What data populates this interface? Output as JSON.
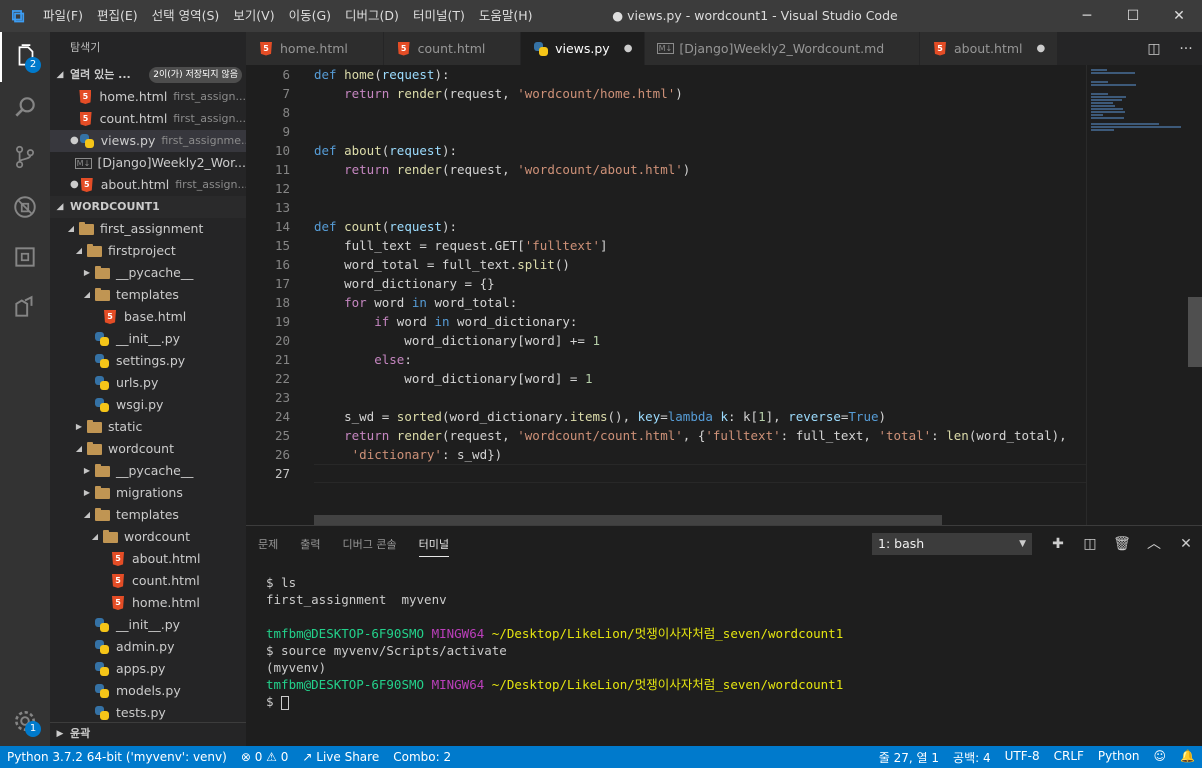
{
  "menu": [
    "파일(F)",
    "편집(E)",
    "선택 영역(S)",
    "보기(V)",
    "이동(G)",
    "디버그(D)",
    "터미널(T)",
    "도움말(H)"
  ],
  "window_title": "● views.py - wordcount1 - Visual Studio Code",
  "activity": {
    "explorer_badge": "2",
    "settings_badge": "1"
  },
  "sidebar": {
    "title": "탐색기",
    "open_editors": {
      "label": "열려 있는 ...",
      "badge": "2이(가) 저장되지 않음",
      "items": [
        {
          "name": "home.html",
          "desc": "first_assign...",
          "dot": ""
        },
        {
          "name": "count.html",
          "desc": "first_assign...",
          "dot": ""
        },
        {
          "name": "views.py",
          "desc": "first_assignme...",
          "dot": "●"
        },
        {
          "name": "[Django]Weekly2_Wor...",
          "desc": "",
          "dot": ""
        },
        {
          "name": "about.html",
          "desc": "first_assign...",
          "dot": "●"
        }
      ]
    },
    "workspace": "WORDCOUNT1",
    "tree": [
      {
        "name": "first_assignment",
        "depth": 1,
        "type": "folder",
        "open": true
      },
      {
        "name": "firstproject",
        "depth": 2,
        "type": "folder",
        "open": true
      },
      {
        "name": "__pycache__",
        "depth": 3,
        "type": "folder",
        "open": false
      },
      {
        "name": "templates",
        "depth": 3,
        "type": "folder",
        "open": true
      },
      {
        "name": "base.html",
        "depth": 4,
        "type": "html"
      },
      {
        "name": "__init__.py",
        "depth": 3,
        "type": "py"
      },
      {
        "name": "settings.py",
        "depth": 3,
        "type": "py"
      },
      {
        "name": "urls.py",
        "depth": 3,
        "type": "py"
      },
      {
        "name": "wsgi.py",
        "depth": 3,
        "type": "py"
      },
      {
        "name": "static",
        "depth": 2,
        "type": "folder",
        "open": false
      },
      {
        "name": "wordcount",
        "depth": 2,
        "type": "folder",
        "open": true
      },
      {
        "name": "__pycache__",
        "depth": 3,
        "type": "folder",
        "open": false
      },
      {
        "name": "migrations",
        "depth": 3,
        "type": "folder",
        "open": false
      },
      {
        "name": "templates",
        "depth": 3,
        "type": "folder",
        "open": true
      },
      {
        "name": "wordcount",
        "depth": 4,
        "type": "folder",
        "open": true
      },
      {
        "name": "about.html",
        "depth": 5,
        "type": "html"
      },
      {
        "name": "count.html",
        "depth": 5,
        "type": "html"
      },
      {
        "name": "home.html",
        "depth": 5,
        "type": "html"
      },
      {
        "name": "__init__.py",
        "depth": 3,
        "type": "py"
      },
      {
        "name": "admin.py",
        "depth": 3,
        "type": "py"
      },
      {
        "name": "apps.py",
        "depth": 3,
        "type": "py"
      },
      {
        "name": "models.py",
        "depth": 3,
        "type": "py"
      },
      {
        "name": "tests.py",
        "depth": 3,
        "type": "py"
      }
    ],
    "outline": "윤곽"
  },
  "tabs": [
    {
      "name": "home.html",
      "type": "html",
      "dirty": false,
      "active": false
    },
    {
      "name": "count.html",
      "type": "html",
      "dirty": false,
      "active": false
    },
    {
      "name": "views.py",
      "type": "py",
      "dirty": true,
      "active": true
    },
    {
      "name": "[Django]Weekly2_Wordcount.md",
      "type": "md",
      "dirty": false,
      "active": false
    },
    {
      "name": "about.html",
      "type": "html",
      "dirty": true,
      "active": false
    }
  ],
  "editor": {
    "current_line": "27",
    "lines": [
      {
        "n": "6",
        "t": [
          [
            "k",
            "def "
          ],
          [
            "f",
            "home"
          ],
          [
            "p",
            "("
          ],
          [
            "v",
            "request"
          ],
          [
            "p",
            "):"
          ]
        ]
      },
      {
        "n": "7",
        "t": [
          [
            "p",
            "    "
          ],
          [
            "c",
            "return "
          ],
          [
            "f",
            "render"
          ],
          [
            "p",
            "(request, "
          ],
          [
            "s",
            "'wordcount/home.html'"
          ],
          [
            "p",
            ")"
          ]
        ]
      },
      {
        "n": "8",
        "t": []
      },
      {
        "n": "9",
        "t": []
      },
      {
        "n": "10",
        "t": [
          [
            "k",
            "def "
          ],
          [
            "f",
            "about"
          ],
          [
            "p",
            "("
          ],
          [
            "v",
            "request"
          ],
          [
            "p",
            "):"
          ]
        ]
      },
      {
        "n": "11",
        "t": [
          [
            "p",
            "    "
          ],
          [
            "c",
            "return "
          ],
          [
            "f",
            "render"
          ],
          [
            "p",
            "(request, "
          ],
          [
            "s",
            "'wordcount/about.html'"
          ],
          [
            "p",
            ")"
          ]
        ]
      },
      {
        "n": "12",
        "t": []
      },
      {
        "n": "13",
        "t": []
      },
      {
        "n": "14",
        "t": [
          [
            "k",
            "def "
          ],
          [
            "f",
            "count"
          ],
          [
            "p",
            "("
          ],
          [
            "v",
            "request"
          ],
          [
            "p",
            "):"
          ]
        ]
      },
      {
        "n": "15",
        "t": [
          [
            "p",
            "    full_text = request.GET["
          ],
          [
            "s",
            "'fulltext'"
          ],
          [
            "p",
            "]"
          ]
        ]
      },
      {
        "n": "16",
        "t": [
          [
            "p",
            "    word_total = full_text."
          ],
          [
            "f",
            "split"
          ],
          [
            "p",
            "()"
          ]
        ]
      },
      {
        "n": "17",
        "t": [
          [
            "p",
            "    word_dictionary = {}"
          ]
        ]
      },
      {
        "n": "18",
        "t": [
          [
            "p",
            "    "
          ],
          [
            "c",
            "for "
          ],
          [
            "p",
            "word "
          ],
          [
            "k",
            "in "
          ],
          [
            "p",
            "word_total:"
          ]
        ]
      },
      {
        "n": "19",
        "t": [
          [
            "p",
            "        "
          ],
          [
            "c",
            "if "
          ],
          [
            "p",
            "word "
          ],
          [
            "k",
            "in "
          ],
          [
            "p",
            "word_dictionary:"
          ]
        ]
      },
      {
        "n": "20",
        "t": [
          [
            "p",
            "            word_dictionary[word] += "
          ],
          [
            "n",
            "1"
          ]
        ]
      },
      {
        "n": "21",
        "t": [
          [
            "p",
            "        "
          ],
          [
            "c",
            "else"
          ],
          [
            "p",
            ":"
          ]
        ]
      },
      {
        "n": "22",
        "t": [
          [
            "p",
            "            word_dictionary[word] = "
          ],
          [
            "n",
            "1"
          ]
        ]
      },
      {
        "n": "23",
        "t": []
      },
      {
        "n": "24",
        "t": [
          [
            "p",
            "    s_wd = "
          ],
          [
            "f",
            "sorted"
          ],
          [
            "p",
            "(word_dictionary."
          ],
          [
            "f",
            "items"
          ],
          [
            "p",
            "(), "
          ],
          [
            "v",
            "key"
          ],
          [
            "p",
            "="
          ],
          [
            "k",
            "lambda "
          ],
          [
            "v",
            "k"
          ],
          [
            "p",
            ": k["
          ],
          [
            "n",
            "1"
          ],
          [
            "p",
            "], "
          ],
          [
            "v",
            "reverse"
          ],
          [
            "p",
            "="
          ],
          [
            "k",
            "True"
          ],
          [
            "p",
            ")"
          ]
        ]
      },
      {
        "n": "25",
        "t": [
          [
            "p",
            "    "
          ],
          [
            "c",
            "return "
          ],
          [
            "f",
            "render"
          ],
          [
            "p",
            "(request, "
          ],
          [
            "s",
            "'wordcount/count.html'"
          ],
          [
            "p",
            ", {"
          ],
          [
            "s",
            "'fulltext'"
          ],
          [
            "p",
            ": full_text, "
          ],
          [
            "s",
            "'total'"
          ],
          [
            "p",
            ": "
          ],
          [
            "f",
            "len"
          ],
          [
            "p",
            "(word_total),"
          ]
        ]
      },
      {
        "n": "26",
        "t": [
          [
            "p",
            "     "
          ],
          [
            "s",
            "'dictionary'"
          ],
          [
            "p",
            ": s_wd})"
          ]
        ]
      },
      {
        "n": "27",
        "t": []
      }
    ]
  },
  "panel": {
    "tabs": [
      {
        "label": "문제",
        "active": false
      },
      {
        "label": "출력",
        "active": false
      },
      {
        "label": "디버그 콘솔",
        "active": false
      },
      {
        "label": "터미널",
        "active": true
      }
    ],
    "terminal_select": "1: bash",
    "terminal": [
      [
        [
          "p",
          "$ ls"
        ]
      ],
      [
        [
          "p",
          "first_assignment  myvenv"
        ]
      ],
      [],
      [
        [
          "g",
          "tmfbm@DESKTOP-6F90SMO "
        ],
        [
          "m",
          "MINGW64 "
        ],
        [
          "y",
          "~/Desktop/LikeLion/멋쟁이사자처럼_seven/wordcount1"
        ]
      ],
      [
        [
          "p",
          "$ source myvenv/Scripts/activate"
        ]
      ],
      [
        [
          "p",
          "(myvenv)"
        ]
      ],
      [
        [
          "g",
          "tmfbm@DESKTOP-6F90SMO "
        ],
        [
          "m",
          "MINGW64 "
        ],
        [
          "y",
          "~/Desktop/LikeLion/멋쟁이사자처럼_seven/wordcount1"
        ]
      ],
      [
        [
          "p",
          "$ "
        ],
        [
          "cursor",
          ""
        ]
      ]
    ]
  },
  "status": {
    "python": "Python 3.7.2 64-bit ('myvenv': venv)",
    "errors": "⊗ 0",
    "warnings": "⚠ 0",
    "liveshare": "Live Share",
    "combo": "Combo: 2",
    "position": "줄 27, 열 1",
    "spaces": "공백: 4",
    "encoding": "UTF-8",
    "eol": "CRLF",
    "language": "Python"
  }
}
